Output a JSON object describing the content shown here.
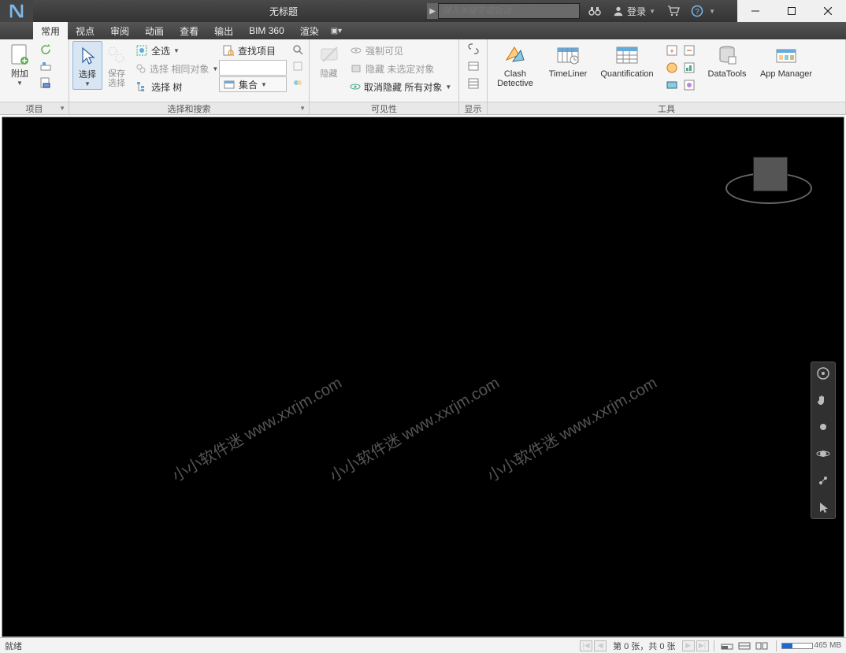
{
  "window": {
    "title": "无标题"
  },
  "qat": {
    "search_placeholder": "键入关键字或短语",
    "login_label": "登录"
  },
  "menu": {
    "tabs": [
      "常用",
      "视点",
      "审阅",
      "动画",
      "查看",
      "输出",
      "BIM 360",
      "渲染"
    ],
    "active_index": 0
  },
  "ribbon": {
    "project": {
      "append_label": "附加",
      "title": "项目"
    },
    "select_search": {
      "select_label": "选择",
      "save_select_label": "保存\n选择",
      "select_all": "全选",
      "select_same": "选择 相同对象",
      "select_tree": "选择 树",
      "find_items": "查找项目",
      "sets_label": "集合",
      "title": "选择和搜索"
    },
    "visibility": {
      "hide_label": "隐藏",
      "force_visible": "强制可见",
      "hide_unselected": "隐藏 未选定对象",
      "unhide_all": "取消隐藏 所有对象",
      "title": "可见性"
    },
    "display": {
      "title": "显示"
    },
    "tools": {
      "clash": "Clash\nDetective",
      "timeliner": "TimeLiner",
      "quant": "Quantification",
      "datatools": "DataTools",
      "appmgr": "App Manager",
      "title": "工具"
    }
  },
  "watermark": "小小软件迷 www.xxrjm.com",
  "status": {
    "ready": "就绪",
    "pager_text": "第 0 张，共 0 张",
    "mem": "465 MB"
  }
}
